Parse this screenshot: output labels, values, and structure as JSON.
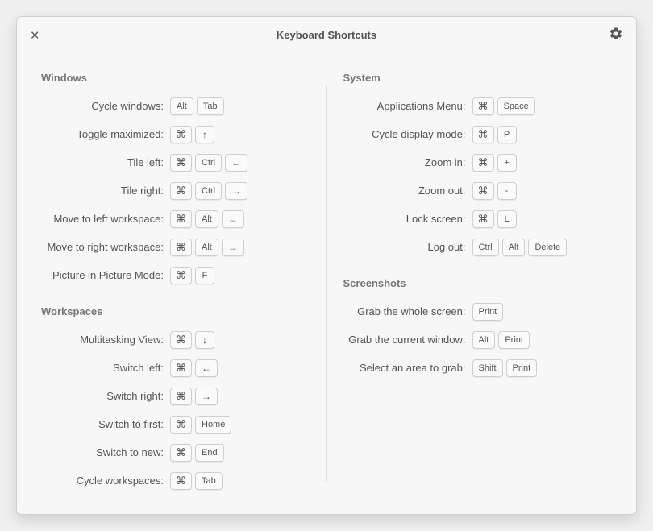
{
  "header": {
    "title": "Keyboard Shortcuts"
  },
  "sections": {
    "windows": {
      "title": "Windows",
      "items": [
        {
          "label": "Cycle windows:",
          "keys": [
            "Alt",
            "Tab"
          ]
        },
        {
          "label": "Toggle maximized:",
          "keys": [
            "⌘",
            "↑"
          ]
        },
        {
          "label": "Tile left:",
          "keys": [
            "⌘",
            "Ctrl",
            "←"
          ]
        },
        {
          "label": "Tile right:",
          "keys": [
            "⌘",
            "Ctrl",
            "→"
          ]
        },
        {
          "label": "Move to left workspace:",
          "keys": [
            "⌘",
            "Alt",
            "←"
          ]
        },
        {
          "label": "Move to right workspace:",
          "keys": [
            "⌘",
            "Alt",
            "→"
          ]
        },
        {
          "label": "Picture in Picture Mode:",
          "keys": [
            "⌘",
            "F"
          ]
        }
      ]
    },
    "workspaces": {
      "title": "Workspaces",
      "items": [
        {
          "label": "Multitasking View:",
          "keys": [
            "⌘",
            "↓"
          ]
        },
        {
          "label": "Switch left:",
          "keys": [
            "⌘",
            "←"
          ]
        },
        {
          "label": "Switch right:",
          "keys": [
            "⌘",
            "→"
          ]
        },
        {
          "label": "Switch to first:",
          "keys": [
            "⌘",
            "Home"
          ]
        },
        {
          "label": "Switch to new:",
          "keys": [
            "⌘",
            "End"
          ]
        },
        {
          "label": "Cycle workspaces:",
          "keys": [
            "⌘",
            "Tab"
          ]
        }
      ]
    },
    "system": {
      "title": "System",
      "items": [
        {
          "label": "Applications Menu:",
          "keys": [
            "⌘",
            "Space"
          ]
        },
        {
          "label": "Cycle display mode:",
          "keys": [
            "⌘",
            "P"
          ]
        },
        {
          "label": "Zoom in:",
          "keys": [
            "⌘",
            "+"
          ]
        },
        {
          "label": "Zoom out:",
          "keys": [
            "⌘",
            "-"
          ]
        },
        {
          "label": "Lock screen:",
          "keys": [
            "⌘",
            "L"
          ]
        },
        {
          "label": "Log out:",
          "keys": [
            "Ctrl",
            "Alt",
            "Delete"
          ]
        }
      ]
    },
    "screenshots": {
      "title": "Screenshots",
      "items": [
        {
          "label": "Grab the whole screen:",
          "keys": [
            "Print"
          ]
        },
        {
          "label": "Grab the current window:",
          "keys": [
            "Alt",
            "Print"
          ]
        },
        {
          "label": "Select an area to grab:",
          "keys": [
            "Shift",
            "Print"
          ]
        }
      ]
    }
  }
}
